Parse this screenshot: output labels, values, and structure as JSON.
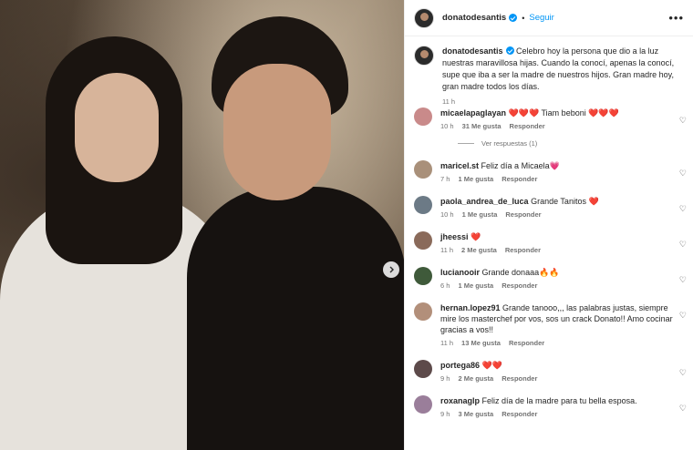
{
  "post": {
    "username": "donatodesantis",
    "follow_label": "Seguir",
    "more_label": "•••",
    "caption_user": "donatodesantis",
    "caption_text": "Celebro hoy la persona que dio a la luz nuestras maravillosa hijas. Cuando la conocí, apenas la conocí, supe que iba a ser la madre de nuestros hijos. Gran madre hoy, gran madre todos los días.",
    "caption_time": "11 h"
  },
  "comments": [
    {
      "user": "micaelapaglayan",
      "text": "❤️❤️❤️ Tiam beboni ❤️❤️❤️",
      "time": "10 h",
      "likes": "31 Me gusta",
      "reply": "Responder",
      "avatar_color": "#c98a8a",
      "view_replies": "Ver respuestas (1)"
    },
    {
      "user": "maricel.st",
      "text": "Feliz día a Micaela💗",
      "time": "7 h",
      "likes": "1 Me gusta",
      "reply": "Responder",
      "avatar_color": "#a9907a"
    },
    {
      "user": "paola_andrea_de_luca",
      "text": "Grande Tanitos ❤️",
      "time": "10 h",
      "likes": "1 Me gusta",
      "reply": "Responder",
      "avatar_color": "#6c7a86"
    },
    {
      "user": "jheessi",
      "text": "❤️",
      "time": "11 h",
      "likes": "2 Me gusta",
      "reply": "Responder",
      "avatar_color": "#8a6a5a"
    },
    {
      "user": "lucianooir",
      "text": "Grande donaaa🔥🔥",
      "time": "6 h",
      "likes": "1 Me gusta",
      "reply": "Responder",
      "avatar_color": "#3f5a3a"
    },
    {
      "user": "hernan.lopez91",
      "text": "Grande tanooo,,, las palabras justas, siempre mire los masterchef por vos, sos un crack Donato!! Amo cocinar gracias a vos!!",
      "time": "11 h",
      "likes": "13 Me gusta",
      "reply": "Responder",
      "avatar_color": "#b28f7a"
    },
    {
      "user": "portega86",
      "text": "❤️❤️",
      "time": "9 h",
      "likes": "2 Me gusta",
      "reply": "Responder",
      "avatar_color": "#5d4a4a"
    },
    {
      "user": "roxanaglp",
      "text": "Feliz día de la madre para tu bella esposa.",
      "time": "9 h",
      "likes": "3 Me gusta",
      "reply": "Responder",
      "avatar_color": "#9a7e9a"
    }
  ],
  "colors": {
    "accent": "#0095f6",
    "muted": "#737373",
    "text": "#262626"
  },
  "icons": {
    "verified": "verified-badge-icon",
    "heart": "heart-outline-icon",
    "next": "chevron-right-icon",
    "more": "more-horizontal-icon"
  }
}
